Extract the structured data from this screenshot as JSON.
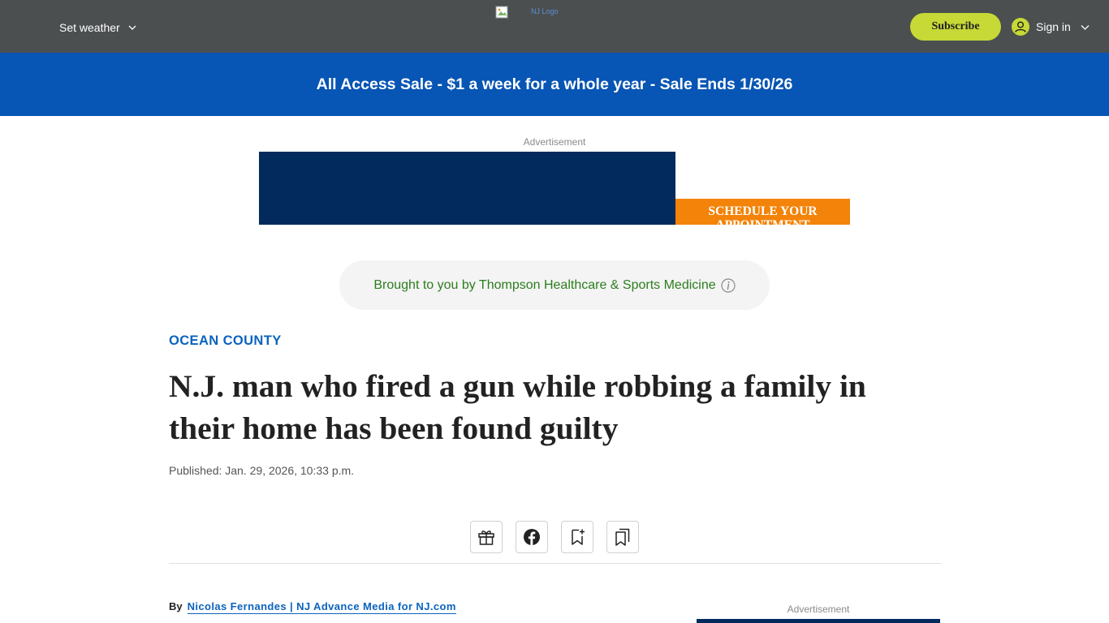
{
  "header": {
    "weather_label": "Set weather",
    "logo_alt": "NJ Logo",
    "subscribe_label": "Subscribe",
    "signin_label": "Sign in"
  },
  "sale_banner": {
    "text": "All Access Sale - $1 a week for a whole year - Sale Ends 1/30/26"
  },
  "ad": {
    "label": "Advertisement",
    "cta_text": "SCHEDULE YOUR APPOINTMENT"
  },
  "sponsor": {
    "text": "Brought to you by Thompson Healthcare & Sports Medicine"
  },
  "article": {
    "section": "OCEAN COUNTY",
    "headline": "N.J. man who fired a gun while robbing a family in their home has been found guilty",
    "published": "Published: Jan. 29, 2026, 10:33 p.m.",
    "byline_prefix": "By",
    "byline_author": "Nicolas Fernandes | NJ Advance Media for NJ.com"
  },
  "share_icons": [
    "gift-icon",
    "facebook-icon",
    "bookmark-add-icon",
    "saved-bookmarks-icon"
  ],
  "right_rail": {
    "ad_label": "Advertisement"
  },
  "colors": {
    "topbar": "#4b4f50",
    "sale_banner": "#0755b4",
    "subscribe_button": "#c6d936",
    "ad_navy": "#022a5c",
    "ad_orange": "#f38309",
    "section_link": "#0b63be",
    "sponsor_text": "#2c7d1e"
  }
}
